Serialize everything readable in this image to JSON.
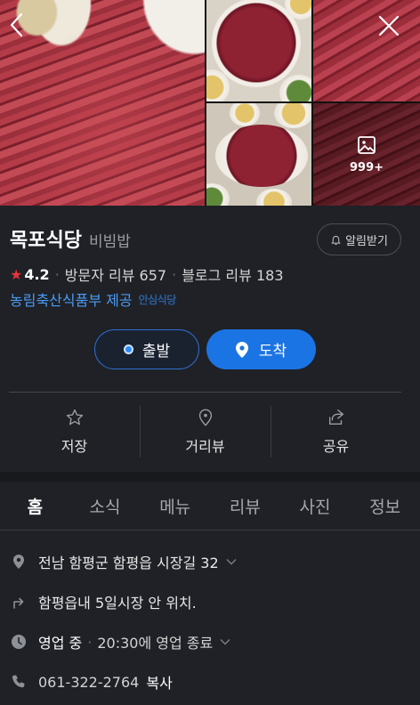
{
  "header": {
    "back_icon": "chevron-left-icon",
    "close_icon": "close-icon",
    "photo_count": "999+",
    "photo_icon": "image-icon"
  },
  "place": {
    "name": "목포식당",
    "category": "비빔밥",
    "alarm_label": "알림받기",
    "rating": "4.2",
    "visitor_review": "방문자 리뷰 657",
    "blog_review": "블로그 리뷰 183",
    "provider": "농림축산식품부 제공",
    "badge": "안심식당"
  },
  "route": {
    "start_label": "출발",
    "arrive_label": "도착"
  },
  "actions": [
    {
      "label": "저장",
      "icon": "star-outline-icon"
    },
    {
      "label": "거리뷰",
      "icon": "location-pin-outline-icon"
    },
    {
      "label": "공유",
      "icon": "share-icon"
    }
  ],
  "tabs": [
    "홈",
    "소식",
    "메뉴",
    "리뷰",
    "사진",
    "정보"
  ],
  "active_tab": "홈",
  "details": {
    "address": "전남 함평군 함평읍 시장길 32",
    "direction": "함평읍내 5일시장 안 위치.",
    "status": "영업 중",
    "hours": "20:30에 영업 종료",
    "phone": "061-322-2764",
    "copy_label": "복사"
  },
  "colors": {
    "background": "#1f2126",
    "accent_blue": "#1b74e4",
    "link_blue": "#4a9bf5",
    "star_red": "#e8333a"
  }
}
